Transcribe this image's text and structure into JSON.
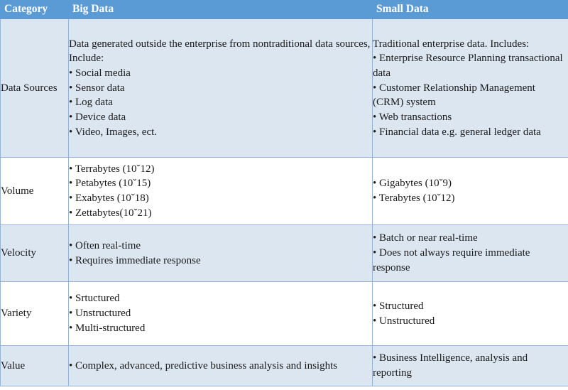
{
  "colors": {
    "header_background": "#5b9bd5",
    "header_text": "#ffffff",
    "row_shade": "#dce6f1",
    "row_plain": "#ffffff",
    "border": "#95b3d7",
    "body_text": "#1a1a1a"
  },
  "table": {
    "headers": {
      "category": "Category",
      "big_data": "Big Data",
      "small_data": "Small Data"
    },
    "rows": [
      {
        "category": "Data Sources",
        "big_data": [
          "Data generated outside the enterprise from nontraditional data sources, Include:",
          "• Social media",
          "• Sensor data",
          "• Log data",
          "• Device data",
          "• Video, Images, ect."
        ],
        "small_data": [
          "Traditional enterprise data. Includes:",
          "• Enterprise Resource Planning transactional data",
          "• Customer Relationship Management (CRM) system",
          "• Web transactions",
          "• Financial data e.g. general ledger data"
        ]
      },
      {
        "category": "Volume",
        "big_data": [
          "• Terrabytes (10ˇ12)",
          "• Petabytes (10ˇ15)",
          "• Exabytes (10ˇ18)",
          "• Zettabytes(10ˇ21)"
        ],
        "small_data": [
          "• Gigabytes (10ˇ9)",
          "• Terabytes (10ˇ12)"
        ]
      },
      {
        "category": "Velocity",
        "big_data": [
          "• Often real-time",
          "• Requires immediate response"
        ],
        "small_data": [
          "• Batch or near real-time",
          "• Does not always require immediate response"
        ]
      },
      {
        "category": "Variety",
        "big_data": [
          "• Srtuctured",
          "• Unstructured",
          "• Multi-structured"
        ],
        "small_data": [
          "• Structured",
          "• Unstructured"
        ]
      },
      {
        "category": "Value",
        "big_data": [
          "• Complex, advanced, predictive business analysis and insights"
        ],
        "small_data": [
          "• Business Intelligence, analysis and reporting"
        ]
      }
    ]
  }
}
